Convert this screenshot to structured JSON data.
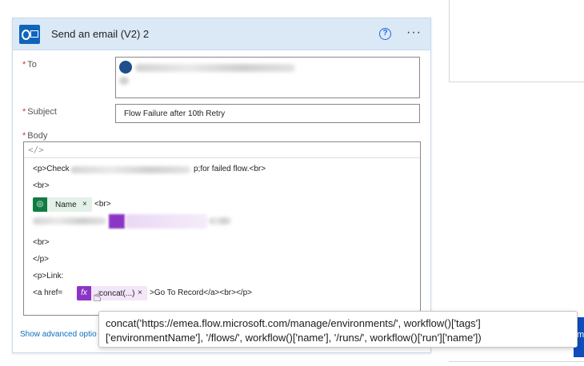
{
  "action": {
    "title": "Send an email (V2) 2",
    "help_icon": "?",
    "more_icon": "···"
  },
  "fields": {
    "to_label": "To",
    "subject_label": "Subject",
    "subject_value": "Flow Failure after 10th Retry",
    "body_label": "Body",
    "required_marker": "*"
  },
  "body": {
    "code_view_icon": "</>",
    "line1_start": "<p>Check",
    "line1_end": "p;for failed flow.<br>",
    "line2": "<br>",
    "token_name": "Name",
    "token_close": "×",
    "after_name": "<br>",
    "line5": "<br>",
    "line6": "</p>",
    "line7": "<p>Link:",
    "line8_start": "<a href=",
    "token_fx_icon": "fx",
    "token_concat": "concat(...)",
    "line8_end": ">Go To Record</a><br></p>"
  },
  "footer": {
    "show_advanced": "Show advanced optio"
  },
  "tooltip": {
    "line1": "concat('https://emea.flow.microsoft.com/manage/environments/', workflow()['tags']",
    "line2": "['environmentName'], '/flows/', workflow()['name'], '/runs/', workflow()['run']['name'])"
  },
  "right_panel": {
    "button_fragment": "m"
  },
  "colors": {
    "header_bg": "#dbe9f7",
    "outlook_blue": "#0f65bb",
    "dataverse_green": "#107c41",
    "expression_purple": "#8b35c5",
    "link_blue": "#0f6cbd",
    "required_red": "#d13438"
  }
}
